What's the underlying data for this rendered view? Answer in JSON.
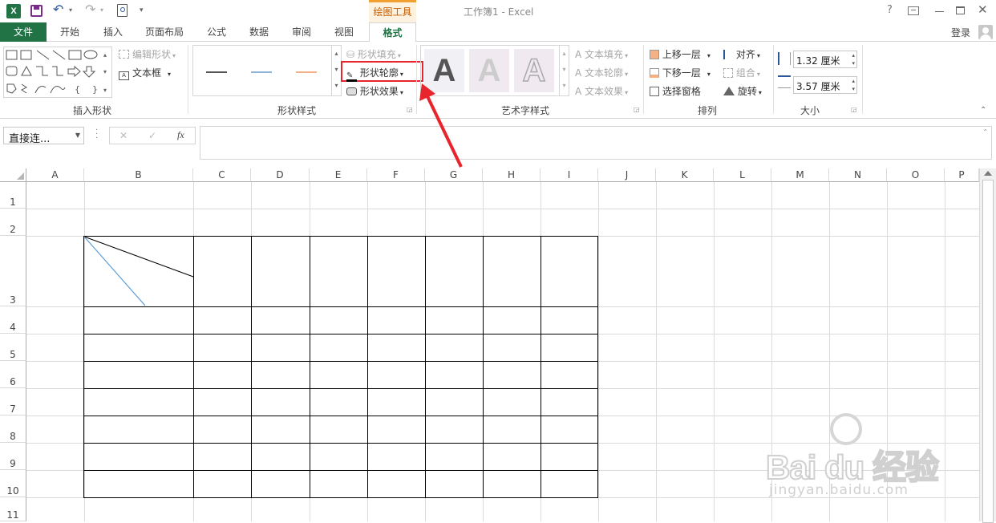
{
  "window": {
    "title": "工作簿1 - Excel",
    "context_tab_group": "绘图工具",
    "help": "?",
    "sign_in": "登录"
  },
  "tabs": [
    "文件",
    "开始",
    "插入",
    "页面布局",
    "公式",
    "数据",
    "审阅",
    "视图",
    "格式"
  ],
  "ribbon": {
    "insert_shapes": {
      "label": "插入形状",
      "edit_shape": "编辑形状",
      "text_box": "文本框"
    },
    "shape_styles": {
      "label": "形状样式",
      "fill": "形状填充",
      "outline": "形状轮廓",
      "effects": "形状效果"
    },
    "wordart_styles": {
      "label": "艺术字样式",
      "text_fill": "文本填充",
      "text_outline": "文本轮廓",
      "text_effects": "文本效果",
      "sample_glyph": "A"
    },
    "arrange": {
      "label": "排列",
      "bring_forward": "上移一层",
      "send_backward": "下移一层",
      "selection_pane": "选择窗格",
      "align": "对齐",
      "group": "组合",
      "rotate": "旋转"
    },
    "size": {
      "label": "大小",
      "height": "1.32 厘米",
      "width": "3.57 厘米"
    }
  },
  "formula_bar": {
    "name_box": "直接连...",
    "cancel": "✕",
    "enter": "✓",
    "fx": "fx",
    "content": ""
  },
  "sheet": {
    "columns": [
      "A",
      "B",
      "C",
      "D",
      "E",
      "F",
      "G",
      "H",
      "I",
      "J",
      "K",
      "L",
      "M",
      "N",
      "O",
      "P"
    ],
    "rows": [
      "1",
      "2",
      "3",
      "4",
      "5",
      "6",
      "7",
      "8",
      "9",
      "10",
      "11"
    ]
  },
  "watermark": {
    "brand": "Bai du 经验",
    "url": "jingyan.baidu.com"
  },
  "colors": {
    "excel_green": "#217346",
    "highlight_red": "#e8242c",
    "diag_black": "#000000",
    "diag_blue": "#5b9bd5",
    "style_line_blue": "#8fb4d9",
    "style_line_orange": "#f4b183"
  }
}
